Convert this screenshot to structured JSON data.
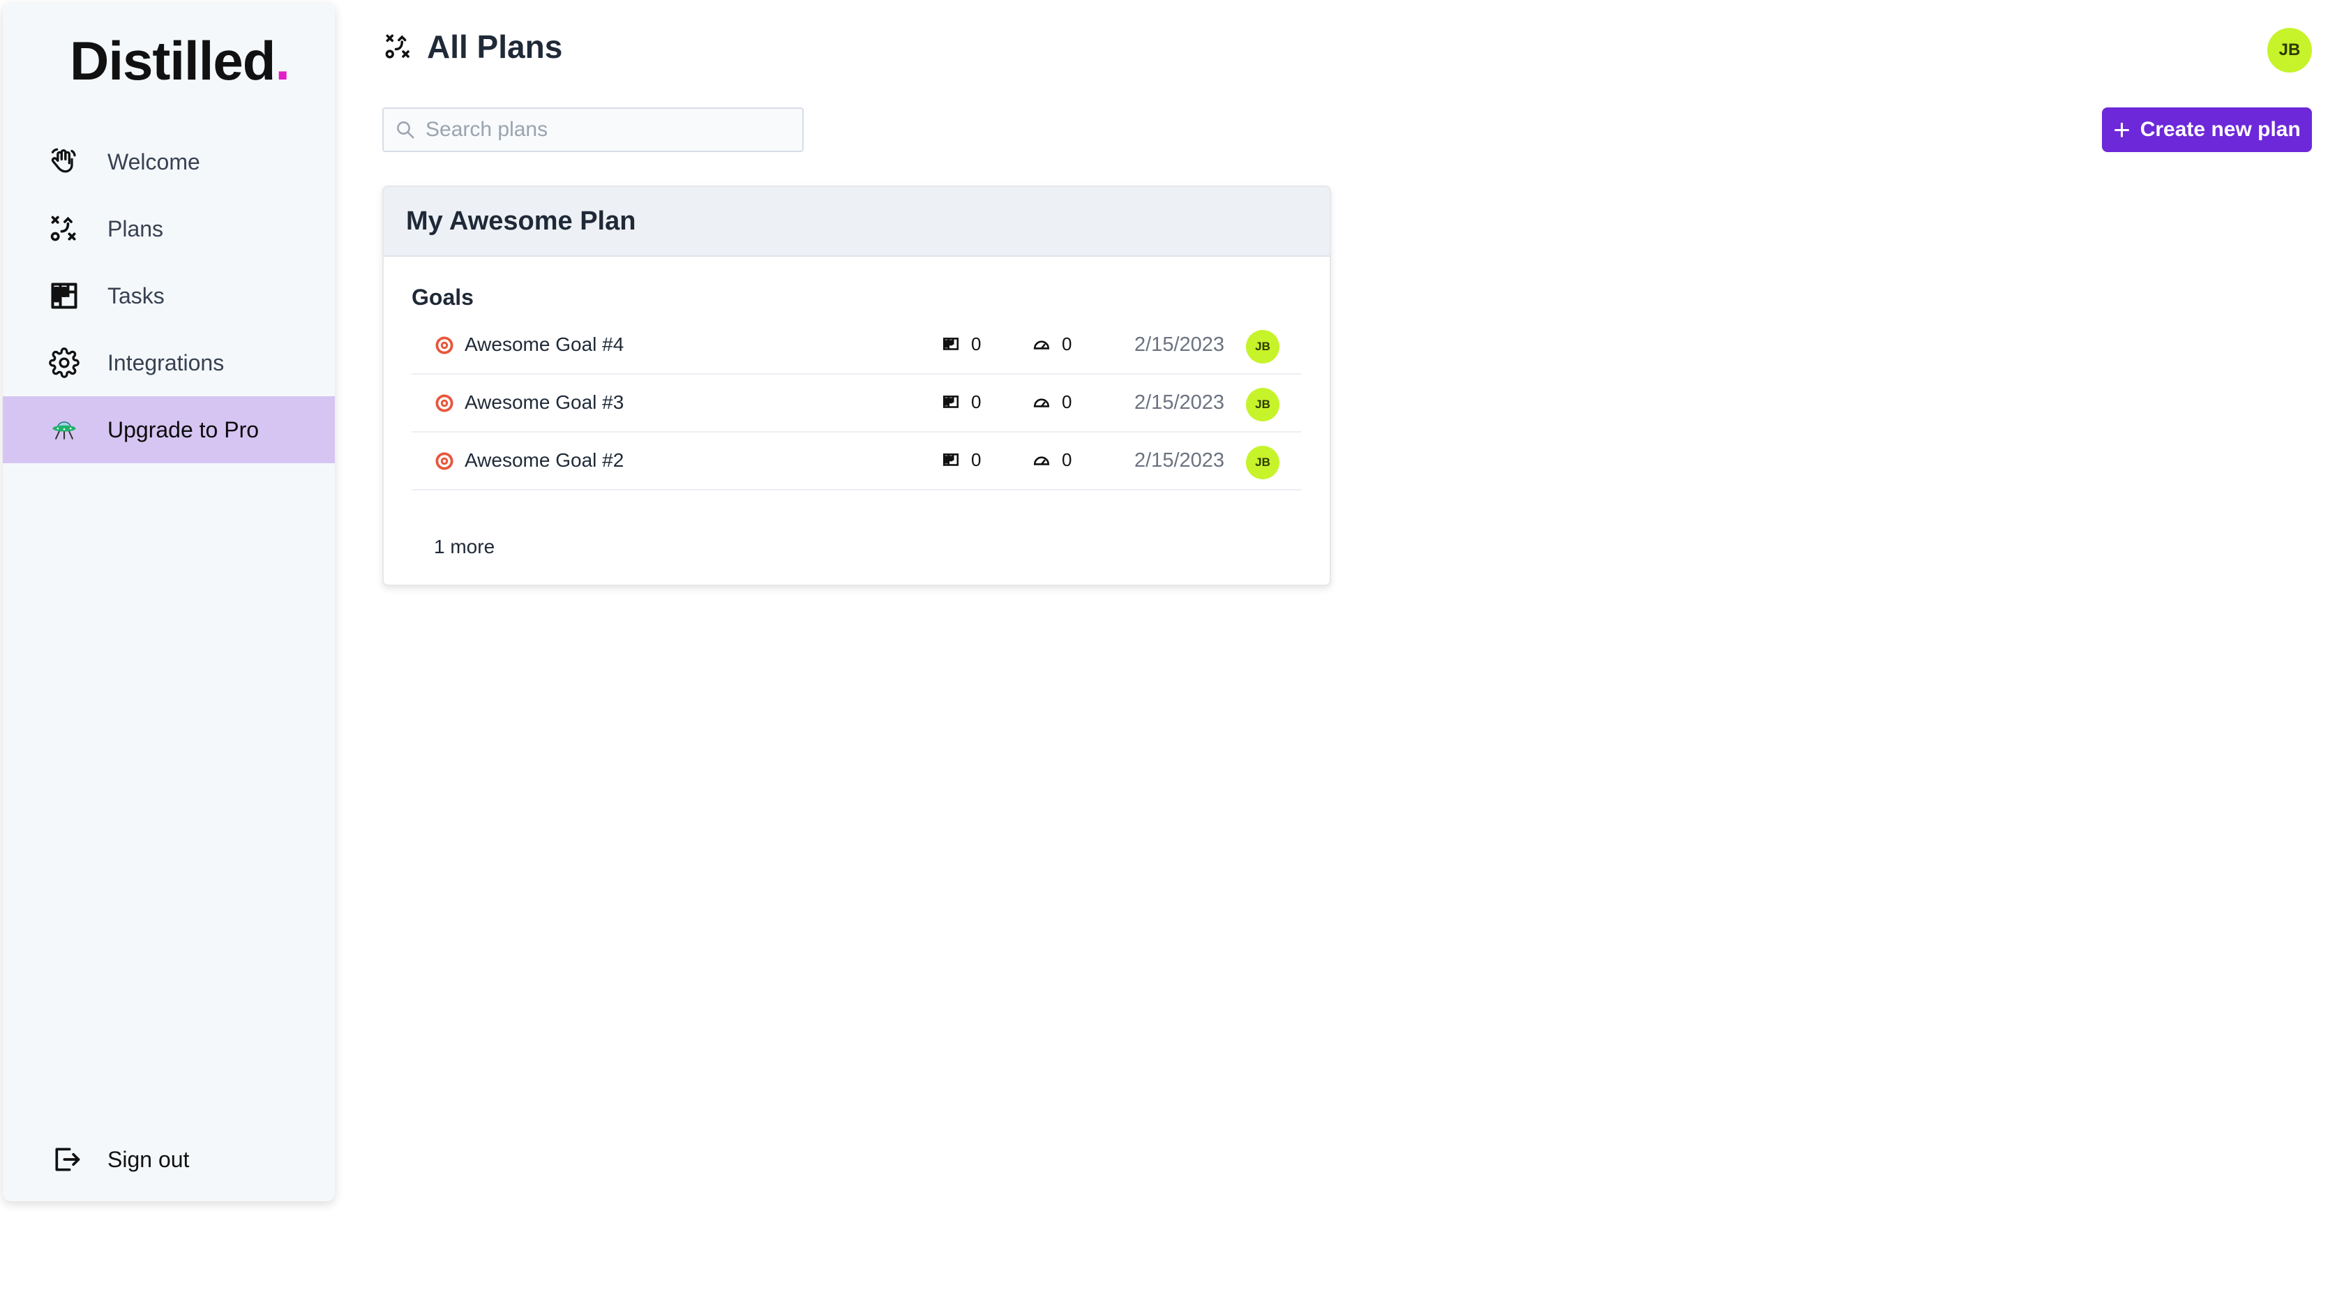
{
  "sidebar": {
    "logo_text": "Distilled",
    "logo_dot": ".",
    "items": [
      {
        "label": "Welcome",
        "icon": "wave-hand-icon"
      },
      {
        "label": "Plans",
        "icon": "strategy-icon"
      },
      {
        "label": "Tasks",
        "icon": "board-icon"
      },
      {
        "label": "Integrations",
        "icon": "gear-icon"
      },
      {
        "label": "Upgrade to Pro",
        "icon": "ufo-icon",
        "active": true
      }
    ],
    "signout_label": "Sign out"
  },
  "header": {
    "title": "All Plans",
    "user_initials": "JB"
  },
  "search": {
    "placeholder": "Search plans",
    "value": ""
  },
  "create_button_label": "Create new plan",
  "plan": {
    "title": "My Awesome Plan",
    "goals_heading": "Goals",
    "goals": [
      {
        "name": "Awesome Goal #4",
        "tasks": "0",
        "progress": "0",
        "date": "2/15/2023",
        "owner": "JB"
      },
      {
        "name": "Awesome Goal #3",
        "tasks": "0",
        "progress": "0",
        "date": "2/15/2023",
        "owner": "JB"
      },
      {
        "name": "Awesome Goal #2",
        "tasks": "0",
        "progress": "0",
        "date": "2/15/2023",
        "owner": "JB"
      }
    ],
    "more_label": "1 more"
  },
  "colors": {
    "accent": "#6d28d9",
    "active_nav": "#d6c5f2",
    "avatar": "#c6f32a",
    "logo_dot": "#e21ec8"
  }
}
